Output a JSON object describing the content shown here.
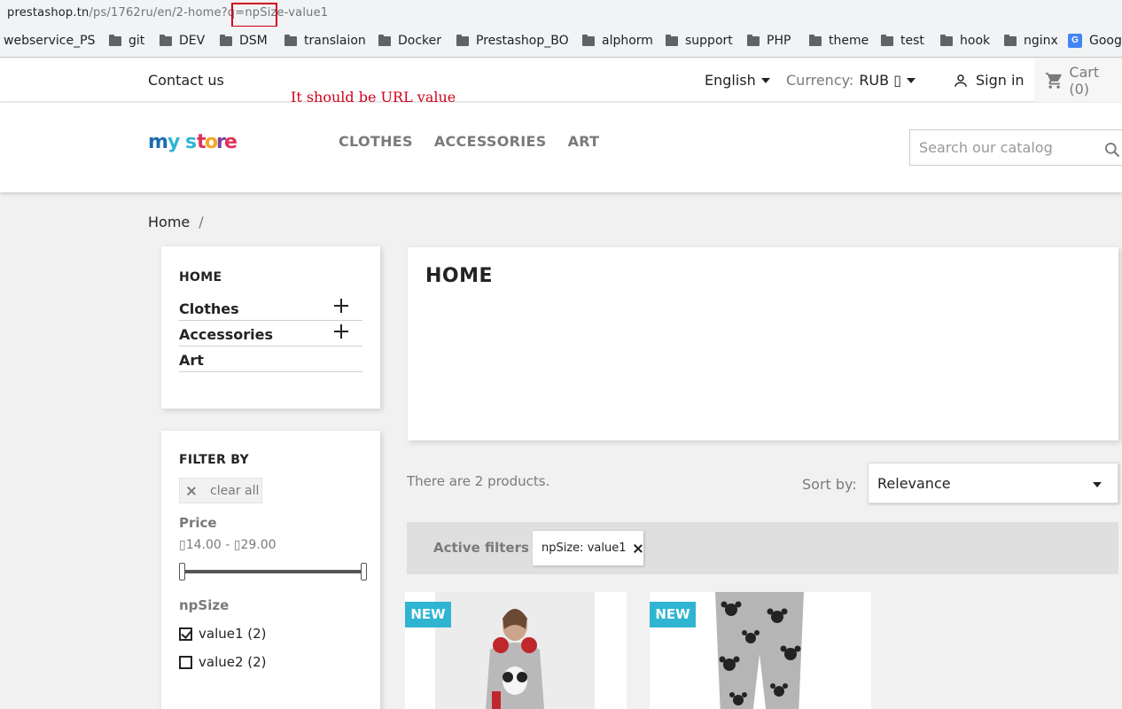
{
  "browser": {
    "url_host": "prestashop.tn",
    "url_path": "/ps/1762ru/en/2-home?q=npSize-value1",
    "bookmarks": [
      {
        "label": "webservice_PS",
        "icon": "none"
      },
      {
        "label": "git",
        "icon": "folder-icon"
      },
      {
        "label": "DEV",
        "icon": "folder-icon"
      },
      {
        "label": "DSM",
        "icon": "folder-icon"
      },
      {
        "label": "translaion",
        "icon": "folder-icon"
      },
      {
        "label": "Docker",
        "icon": "folder-icon"
      },
      {
        "label": "Prestashop_BO",
        "icon": "folder-icon"
      },
      {
        "label": "alphorm",
        "icon": "folder-icon"
      },
      {
        "label": "support",
        "icon": "folder-icon"
      },
      {
        "label": "PHP",
        "icon": "folder-icon"
      },
      {
        "label": "theme",
        "icon": "folder-icon"
      },
      {
        "label": "test",
        "icon": "folder-icon"
      },
      {
        "label": "hook",
        "icon": "folder-icon"
      },
      {
        "label": "nginx",
        "icon": "folder-icon"
      },
      {
        "label": "Goog",
        "icon": "google-translate-icon"
      }
    ]
  },
  "annotation": {
    "text": "It should be URL value",
    "color": "#d0021b"
  },
  "topnav": {
    "contact": "Contact us",
    "language": "English",
    "currency_label": "Currency:",
    "currency_value": "RUB ▯",
    "signin": "Sign in",
    "cart": "Cart (0)"
  },
  "header": {
    "logo_text": "my store",
    "menu": [
      "CLOTHES",
      "ACCESSORIES",
      "ART"
    ],
    "search_placeholder": "Search our catalog"
  },
  "breadcrumb": {
    "home": "Home",
    "separator": "/"
  },
  "categories": {
    "title": "HOME",
    "items": [
      {
        "label": "Clothes",
        "expandable": true
      },
      {
        "label": "Accessories",
        "expandable": true
      },
      {
        "label": "Art",
        "expandable": false
      }
    ]
  },
  "filters": {
    "title": "FILTER BY",
    "clear_all": "clear all",
    "price_title": "Price",
    "price_range": "▯14.00 - ▯29.00",
    "npsize_title": "npSize",
    "options": [
      {
        "label": "value1 (2)",
        "checked": true
      },
      {
        "label": "value2 (2)",
        "checked": false
      }
    ]
  },
  "main": {
    "title": "HOME",
    "products_count": "There are 2 products.",
    "sort_label": "Sort by:",
    "sort_value": "Relevance",
    "active_filters_label": "Active filters",
    "active_filter_chip": "npSize: value1",
    "accent_color": "#2fb5d2",
    "products": [
      {
        "badge": "NEW"
      },
      {
        "badge": "NEW"
      }
    ]
  }
}
